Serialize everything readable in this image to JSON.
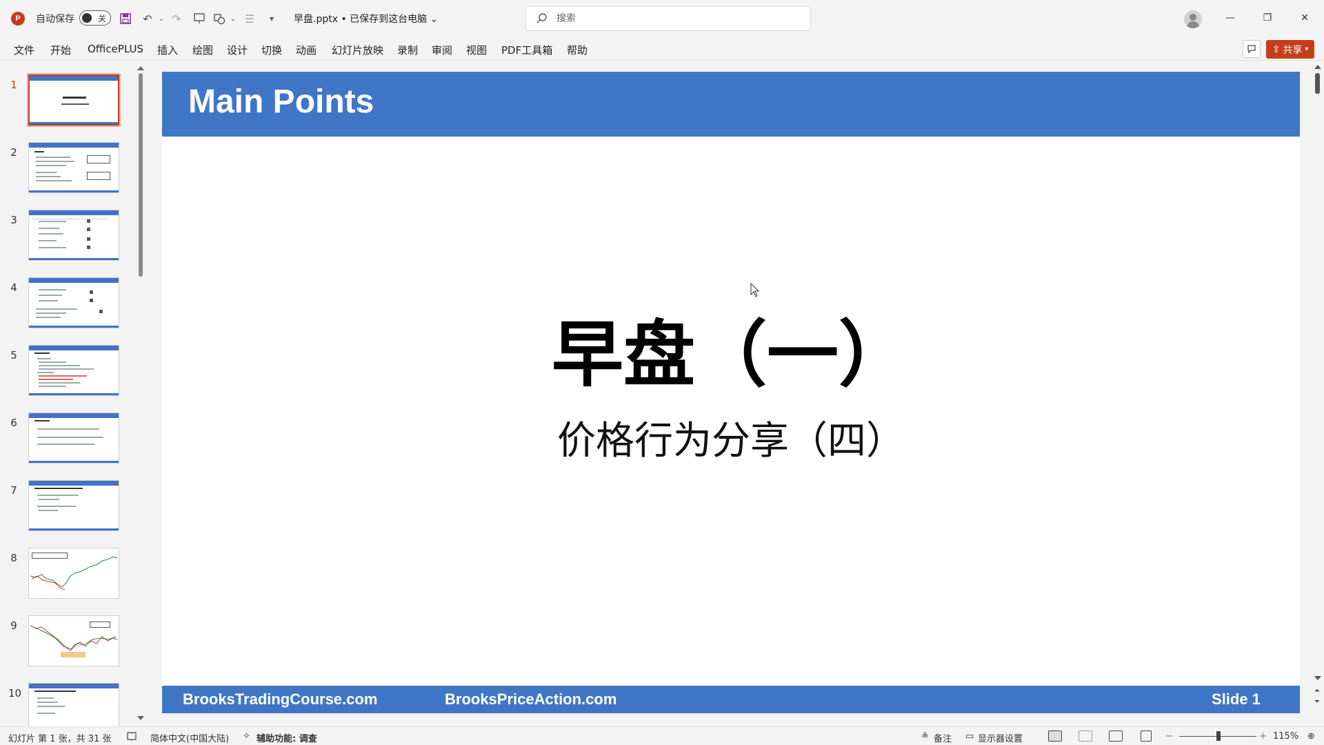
{
  "titlebar": {
    "autosave_label": "自动保存",
    "autosave_state": "关",
    "doc_title": "早盘.pptx • 已保存到这台电脑 ⌄",
    "search_placeholder": "搜索"
  },
  "menu": {
    "items": [
      "文件",
      "开始",
      "OfficePLUS",
      "插入",
      "绘图",
      "设计",
      "切换",
      "动画",
      "幻灯片放映",
      "录制",
      "审阅",
      "视图",
      "PDF工具箱",
      "帮助"
    ],
    "share_label": "共享"
  },
  "thumbnails": {
    "numbers": [
      "1",
      "2",
      "3",
      "4",
      "5",
      "6",
      "7",
      "8",
      "9",
      "10"
    ],
    "active_index": 1
  },
  "slide": {
    "heading": "Main Points",
    "title": "早盘（一）",
    "subtitle": "价格行为分享（四）",
    "footer_left": "BrooksTradingCourse.com",
    "footer_mid": "BrooksPriceAction.com",
    "footer_right": "Slide  1"
  },
  "status": {
    "slide_info": "幻灯片 第 1 张，共 31 张",
    "language": "简体中文(中国大陆)",
    "accessibility": "辅助功能: 调查",
    "notes": "备注",
    "display_settings": "显示器设置",
    "zoom": "115%"
  },
  "colors": {
    "accent": "#c43e1c",
    "slide_blue": "#3f77c6"
  }
}
